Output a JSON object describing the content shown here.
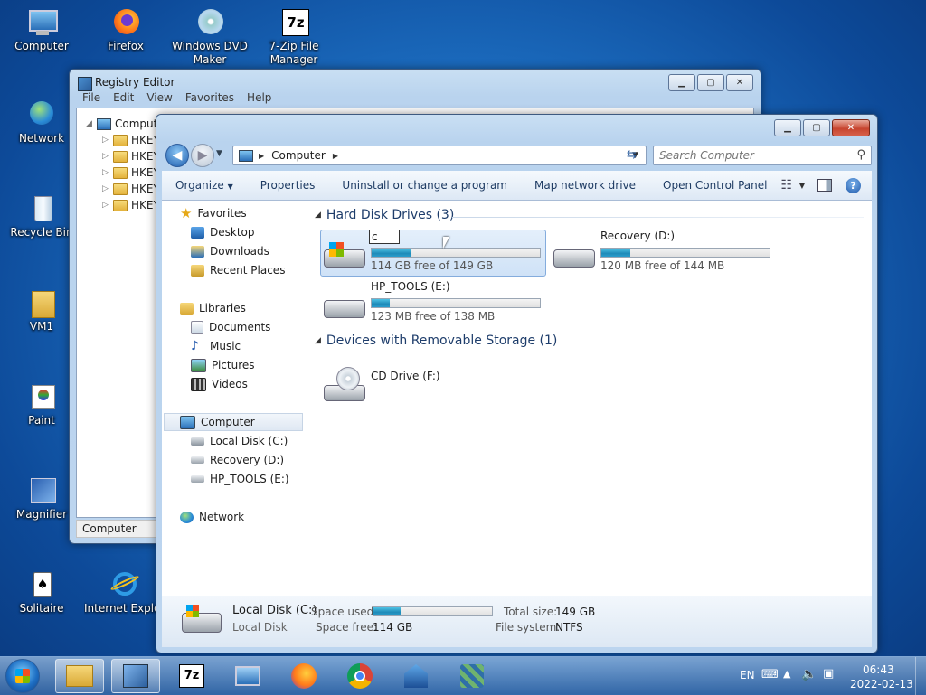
{
  "desktop": {
    "icons": [
      {
        "label": "Computer"
      },
      {
        "label": "Firefox"
      },
      {
        "label": "Windows DVD Maker"
      },
      {
        "label": "7-Zip File Manager"
      },
      {
        "label": "Network"
      },
      {
        "label": "Recycle Bin"
      },
      {
        "label": "VM1"
      },
      {
        "label": "Paint"
      },
      {
        "label": "Magnifier"
      },
      {
        "label": "Solitaire"
      },
      {
        "label": "Internet Explorer"
      }
    ]
  },
  "registry": {
    "title": "Registry Editor",
    "menu": [
      "File",
      "Edit",
      "View",
      "Favorites",
      "Help"
    ],
    "root": "Computer",
    "keys": [
      "HKEY",
      "HKEY",
      "HKEY",
      "HKEY",
      "HKEY"
    ],
    "status": "Computer"
  },
  "explorer": {
    "address": {
      "root_icon": "computer-icon",
      "crumb": "Computer"
    },
    "search_placeholder": "Search Computer",
    "commands": [
      "Organize",
      "Properties",
      "Uninstall or change a program",
      "Map network drive",
      "Open Control Panel"
    ],
    "nav": {
      "favorites": "Favorites",
      "favorites_items": [
        "Desktop",
        "Downloads",
        "Recent Places"
      ],
      "libraries": "Libraries",
      "libraries_items": [
        "Documents",
        "Music",
        "Pictures",
        "Videos"
      ],
      "computer": "Computer",
      "computer_items": [
        "Local Disk (C:)",
        "Recovery (D:)",
        "HP_TOOLS (E:)"
      ],
      "network": "Network"
    },
    "groups": {
      "hdd": "Hard Disk Drives (3)",
      "removable": "Devices with Removable Storage (1)"
    },
    "drives": [
      {
        "name": "c",
        "free": "114 GB free of 149 GB",
        "used_fraction": 0.23
      },
      {
        "name": "Recovery (D:)",
        "free": "120 MB free of 144 MB",
        "used_fraction": 0.17
      },
      {
        "name": "HP_TOOLS (E:)",
        "free": "123 MB free of 138 MB",
        "used_fraction": 0.11
      }
    ],
    "cd": {
      "name": "CD Drive (F:)"
    },
    "details": {
      "name": "Local Disk (C:)",
      "type": "Local Disk",
      "space_used_label": "Space used:",
      "space_free_label": "Space free:",
      "space_free": "114 GB",
      "total_size_label": "Total size:",
      "total_size": "149 GB",
      "filesystem_label": "File system:",
      "filesystem": "NTFS",
      "used_fraction": 0.23
    }
  },
  "taskbar": {
    "lang": "EN",
    "time": "06:43",
    "date": "2022-02-13"
  }
}
